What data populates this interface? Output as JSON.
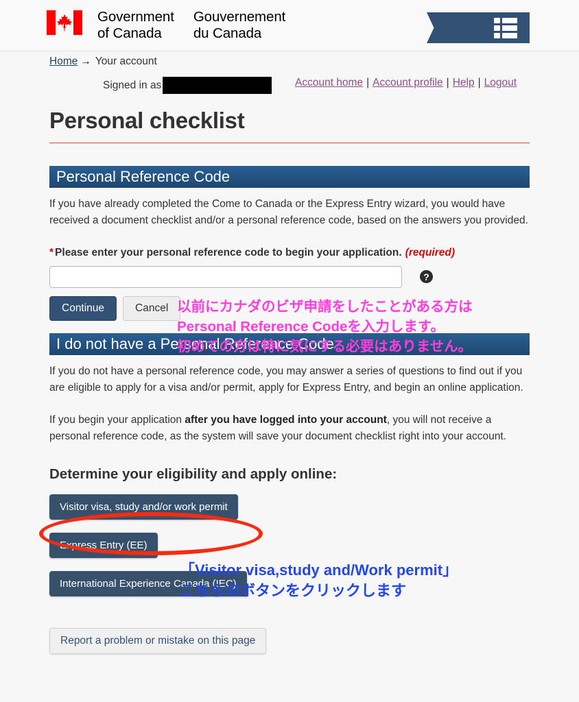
{
  "header": {
    "flag_icon": "canada-flag-icon",
    "wordmark_en": "Government\nof Canada",
    "wordmark_fr": "Gouvernement\ndu Canada",
    "menu_icon": "list-grid-icon"
  },
  "breadcrumb": {
    "home_label": "Home",
    "arrow": "→",
    "current_label": "Your account"
  },
  "account_bar": {
    "signed_in_label": "Signed in as",
    "user_name_redacted": "",
    "links": [
      {
        "label": "Account home"
      },
      {
        "label": "Account profile"
      },
      {
        "label": "Help"
      },
      {
        "label": "Logout"
      }
    ],
    "separator": "|"
  },
  "page": {
    "title": "Personal checklist"
  },
  "section_prc": {
    "banner": "Personal Reference Code",
    "intro": "If you have already completed the Come to Canada or the Express Entry wizard, you would have received a document checklist and/or a personal reference code, based on the answers you provided.",
    "field_star": "*",
    "field_label": "Please enter your personal reference code to begin your application.",
    "field_required": "(required)",
    "input_value": "",
    "input_placeholder": "",
    "help_icon": "question-mark-icon",
    "continue_label": "Continue",
    "cancel_label": "Cancel"
  },
  "section_no_prc": {
    "banner": "I do not have a Personal Reference Code",
    "paragraph1": "If you do not have a personal reference code, you may answer a series of questions to find out if you are eligible to apply for a visa and/or permit, apply for Express Entry, and begin an online application.",
    "paragraph2_pre": "If you begin your application ",
    "paragraph2_bold": "after you have logged into your account",
    "paragraph2_post": ", you will not receive a personal reference code, as the system will save your document checklist right into your account."
  },
  "eligibility": {
    "heading": "Determine your eligibility and apply online:",
    "buttons": [
      {
        "label": "Visitor visa, study and/or work permit"
      },
      {
        "label": "Express Entry (EE)"
      },
      {
        "label": "International Experience Canada (IEC)"
      }
    ]
  },
  "footer": {
    "report_label": "Report a problem or mistake on this page"
  },
  "annotations": {
    "magenta_text": "以前にカナダのビザ申請をしたことがある方は\nPersonal Reference Codeを入力します。\n初めての方は特に気にする必要はありません。",
    "magenta_color": "#ff3ddc",
    "blue_text": "「Visitor visa,study and/Work permit」\nこちらのボタンをクリックします",
    "blue_color": "#2347e8",
    "ellipse_color": "#f42d12",
    "ellipse_target": "Visitor visa, study and/or work permit"
  }
}
